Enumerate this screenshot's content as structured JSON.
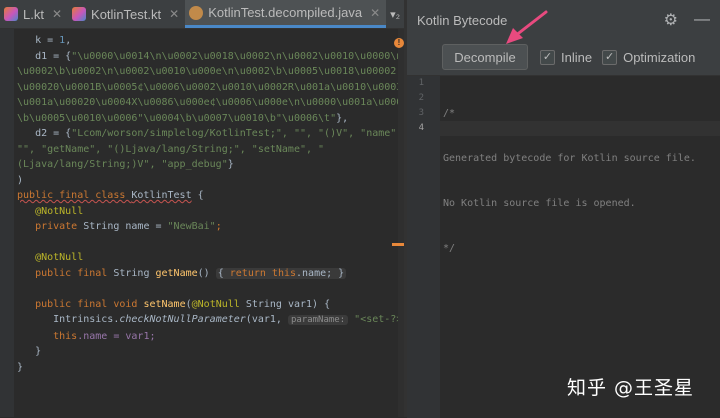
{
  "tabs": [
    {
      "label": "L.kt",
      "icon": "kotlin-file-icon"
    },
    {
      "label": "KotlinTest.kt",
      "icon": "kotlin-file-icon"
    },
    {
      "label": "KotlinTest.decompiled.java",
      "icon": "java-class-icon"
    }
  ],
  "tab_more": "▾₂",
  "panel": {
    "title": "Kotlin Bytecode",
    "decompile_label": "Decompile",
    "inline_label": "Inline",
    "optimization_label": "Optimization"
  },
  "bytecode": {
    "line_numbers": [
      "1",
      "2",
      "3",
      "4"
    ],
    "lines": [
      "/*",
      "Generated bytecode for Kotlin source file.",
      "No Kotlin source file is opened.",
      "*/"
    ]
  },
  "code": {
    "l1_key": "k = ",
    "l1_val": "1",
    "l1_end": ",",
    "l2_key": "d1 = {",
    "l2_str": "\"\\u0000\\u0014\\n\\u0002\\u0018\\u0002\\n\\u0002\\u0010\\u0000\\n",
    "l3_str": "\\u0002\\b\\u0002\\n\\u0002\\u0010\\u000e\\n\\u0002\\b\\u0005\\u0018\\u00002",
    "l4_str": "\\u00020\\u0001B\\u0005¢\\u0006\\u0002\\u0010\\u0002R\\u001a\\u0010\\u0003",
    "l5_str": "\\u001a\\u00020\\u0004X\\u0086\\u000e¢\\u0006\\u000e\\n\\u0000\\u001a\\u0004",
    "l6_str": "\\b\\u0005\\u0010\\u0006\"\\u0004\\b\\u0007\\u0010\\b\"\\u0006\\t\"",
    "l6_end": "},",
    "l7_key": "d2 = {",
    "l7_str": "\"Lcom/worson/simplelog/KotlinTest;\", \"\", \"()V\", \"name\",",
    "l8_str": "\"\", \"getName\", \"()Ljava/lang/String;\", \"setName\", \"",
    "l9_str": "(Ljava/lang/String;)V\", \"app_debug\"",
    "l9_end": "}",
    "l10": ")",
    "kw_public_final_class": "public final class ",
    "class_name": "KotlinTest",
    "brace_open": " {",
    "notnull": "@NotNull",
    "kw_private": "private ",
    "t_string": "String name = ",
    "str_newbai": "\"NewBai\"",
    "semi": ";",
    "kw_public_final": "public final ",
    "getname_ret": "String ",
    "getname": "getName",
    "getname_sig": "() ",
    "fold_body_open": "{ ",
    "kw_return": "return ",
    "kw_this": "this",
    "getname_body": ".name; ",
    "fold_body_close": "}",
    "kw_void": "void ",
    "setname": "setName",
    "paren_open": "(",
    "setname_params": " String var1) {",
    "intrinsics": "Intrinsics.",
    "check": "checkNotNullParameter",
    "call_args": "(var1, ",
    "param_hint": "paramName:",
    "str_set": "\"<set-?>\"",
    "call_end": ");",
    "assign": ".name = var1;",
    "brace_close": "}"
  },
  "warning_glyph": "!",
  "watermark": "知乎 @王圣星",
  "colors": {
    "accent_arrow": "#e84a7f",
    "keyword": "#cc7832",
    "string": "#6a8759",
    "annotation": "#bbb529",
    "function": "#ffc66d",
    "field": "#9876aa"
  }
}
